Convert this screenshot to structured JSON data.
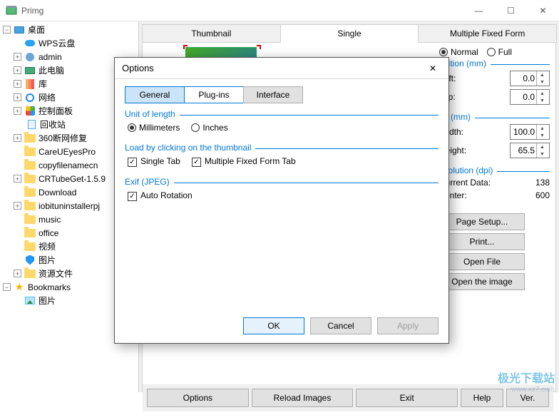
{
  "app": {
    "title": "Primg"
  },
  "tree": {
    "desktop": "桌面",
    "wps": "WPS云盘",
    "admin": "admin",
    "thispc": "此电脑",
    "lib": "库",
    "network": "网络",
    "cpanel": "控制面板",
    "recycle": "回收站",
    "n360": "360断网修复",
    "careueyes": "CareUEyesPro",
    "copyfn": "copyfilenamecn",
    "crtube": "CRTubeGet-1.5.9",
    "download": "Download",
    "iobit": "iobituninstallerpj",
    "music": "music",
    "office": "office",
    "video": "视频",
    "pics": "图片",
    "resfiles": "资源文件",
    "bookmarks": "Bookmarks",
    "bm_pics": "图片"
  },
  "tabs": {
    "thumbnail": "Thumbnail",
    "single": "Single",
    "mff": "Multiple Fixed Form"
  },
  "panel": {
    "normal": "Normal",
    "full": "Full",
    "position_legend": "osition (mm)",
    "left_label": "Left:",
    "left_val": "0.0",
    "top_label": "Top:",
    "top_val": "0.0",
    "size_legend": "ze (mm)",
    "width_label": "Width:",
    "width_val": "100.0",
    "height_label": "Height:",
    "height_val": "65.5",
    "res_legend": "esolution (dpi)",
    "curdata_label": "Current Data:",
    "curdata_val": "138",
    "printer_label": "Printer:",
    "printer_val": "600",
    "page_setup": "Page Setup...",
    "print": "Print...",
    "open_file": "Open File",
    "open_image": "Open the image"
  },
  "bottom": {
    "options": "Options",
    "reload": "Reload Images",
    "exit": "Exit",
    "help": "Help",
    "ver": "Ver."
  },
  "dialog": {
    "title": "Options",
    "tabs": {
      "general": "General",
      "plugins": "Plug-ins",
      "interface": "Interface"
    },
    "unit_legend": "Unit of length",
    "mm": "Millimeters",
    "inches": "Inches",
    "load_legend": "Load by clicking on the thumbnail",
    "single_tab": "Single Tab",
    "mff_tab": "Multiple Fixed Form Tab",
    "exif_legend": "Exif (JPEG)",
    "auto_rot": "Auto Rotation",
    "ok": "OK",
    "cancel": "Cancel",
    "apply": "Apply"
  },
  "watermark": {
    "l1": "极光下载站",
    "l2": "www.xz7.com"
  }
}
